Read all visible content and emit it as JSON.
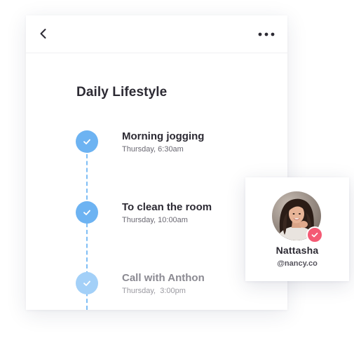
{
  "header": {
    "back_icon": "chevron-left-icon",
    "more_icon": "more-horizontal-icon"
  },
  "page": {
    "title": "Daily Lifestyle"
  },
  "tasks": [
    {
      "title": "Morning jogging",
      "time": "Thursday, 6:30am",
      "status": "done",
      "color": "#6db3f2"
    },
    {
      "title": "To clean the room",
      "time": "Thursday, 10:00am",
      "status": "done",
      "color": "#6db3f2"
    },
    {
      "title": "Call with Anthon",
      "time": "Thursday,  3:00pm",
      "status": "done",
      "color": "#a3d0f8"
    }
  ],
  "profile": {
    "name": "Nattasha",
    "handle": "@nancy.co",
    "verified_icon": "check-badge-icon",
    "verified_color": "#f45a74"
  }
}
